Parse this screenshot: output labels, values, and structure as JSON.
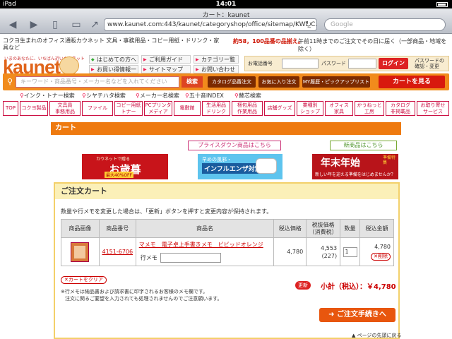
{
  "status_bar": {
    "carrier": "iPad",
    "time": "14:01"
  },
  "browser": {
    "page_title": "カート：kaunet",
    "url": "www.kaunet.com:443/kaunet/categoryshop/office/sitemap/KWf_C...",
    "search_placeholder": "Google",
    "back_icon": "back-arrow-icon",
    "forward_icon": "forward-arrow-icon"
  },
  "header": {
    "tagline": "コクヨ生まれのオフィス通販カウネット 文具・事務用品・コピー用紙・ドリンク・家具など",
    "promo_count": "約58，100品番の品揃え。",
    "promo_delivery": "午前11時までのご注文でその日に届く（一部商品・地域を除く）",
    "logo_catch": "いまのあなたに、いちばん近いカウネット",
    "logo_text": "kaunet",
    "links": [
      "はじめての方へ",
      "ご利用ガイド",
      "カテゴリー覧",
      "お買い得情報一覧",
      "サイトマップ",
      "お問い合わせ"
    ],
    "login": {
      "tel_label": "お電話番号",
      "pw_label": "パスワード",
      "button": "ログイン",
      "forgot": "パスワードの確認・変更"
    }
  },
  "searchbar": {
    "placeholder": "キーワード・商品番号・メーカー名などを入れてください",
    "search_button": "検索",
    "catalog_button": "カタログ品番注文",
    "favorites_button": "お気に入り注文",
    "history_button": "MY履歴・ピックアップリスト",
    "cart_button": "カートを見る"
  },
  "sublinks": [
    "インク・トナー検索",
    "シヤチハタ検索",
    "メーカー名検索",
    "五十音INDEX",
    "替芯検索"
  ],
  "category_tabs": [
    "TOP",
    "コクヨ製品",
    "文具員\n事務用品",
    "ファイル",
    "コピー用紙\nトナー",
    "PCプリンタ\nメディア",
    "電敷館",
    "生活用品\nドリンク",
    "梱包用品\n作業用品",
    "店舗グッズ",
    "業種別\nショップ",
    "オフィス\n家具",
    "かうねっと\n工房",
    "カタログ\n非掲載品",
    "お取り寄せ\nサービス"
  ],
  "cart": {
    "heading": "カート",
    "price_down": "プライスダウン商品はこちら",
    "new_products": "新商品はこちら",
    "banners": {
      "oseibo_small": "カウネットで贈る",
      "oseibo_big": "お歳暮",
      "oseibo_tag": "最大40%OFF",
      "flu_small": "早めの風邪・",
      "flu_big": "インフルエンザ対策を",
      "newyear_big": "年末年始",
      "newyear_right": "準備特集",
      "newyear_small": "新しい年を迎える準備をはじめませんか？"
    }
  },
  "order": {
    "title": "ご注文カート",
    "note": "数量や行メモを変更した場合は、「更新」ボタンを押すと変更内容が保持されます。",
    "columns": [
      "商品画像",
      "商品番号",
      "商品名",
      "税込価格",
      "税抜価格\n（消費税）",
      "数量",
      "税込金額"
    ],
    "items": [
      {
        "number": "4151-6706",
        "name": "マメモ　電子卓上手書きメモ　ビビッドオレンジ",
        "memo_label": "行メモ",
        "price_incl": "4,780",
        "price_excl": "4,553",
        "tax": "(227)",
        "qty": "1",
        "total": "4,780",
        "delete_label": "削除"
      }
    ],
    "clear_button": "カートをクリア",
    "update_button": "更新",
    "subtotal": "小計（税込）：￥4,780",
    "notice1": "※行メモは納品書および請求書に印字されるお客様のメモ欄です。",
    "notice2": "注文に関るご要望を入力されても処理されませんのでご注意願います。",
    "checkout_button": "ご注文手続きへ",
    "page_top": "ページの先頭に戻る"
  }
}
